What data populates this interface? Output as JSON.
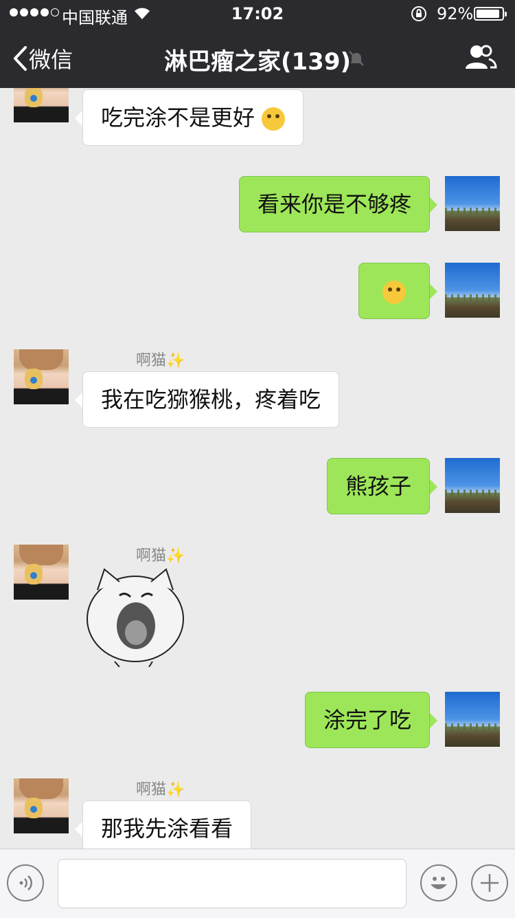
{
  "status": {
    "carrier": "中国联通",
    "time": "17:02",
    "battery": "92%",
    "battery_level": 0.92
  },
  "nav": {
    "back_label": "微信",
    "title": "淋巴瘤之家(139)"
  },
  "messages": [
    {
      "type": "text",
      "direction": "in",
      "text": "吃完涂不是更好"
    },
    {
      "type": "text",
      "direction": "out",
      "text": "看来你是不够疼"
    },
    {
      "type": "emoji",
      "direction": "out",
      "text": ""
    },
    {
      "type": "text",
      "direction": "in",
      "sender": "啊猫",
      "text": "我在吃猕猴桃，疼着吃"
    },
    {
      "type": "text",
      "direction": "out",
      "text": "熊孩子"
    },
    {
      "type": "sticker",
      "direction": "in",
      "sender": "啊猫"
    },
    {
      "type": "text",
      "direction": "out",
      "text": "涂完了吃"
    },
    {
      "type": "text",
      "direction": "in",
      "sender": "啊猫",
      "text": "那我先涂看看"
    }
  ],
  "input": {
    "placeholder": "",
    "value": ""
  },
  "icons": {
    "voice": "voice-icon",
    "emoji": "emoji-icon",
    "plus": "plus-icon",
    "people": "group-members-icon",
    "mute": "mute-bell-icon"
  },
  "colors": {
    "nav_bg": "#2b2b2f",
    "chat_bg": "#ebebeb",
    "out_bubble": "#9de659",
    "in_bubble": "#ffffff"
  }
}
